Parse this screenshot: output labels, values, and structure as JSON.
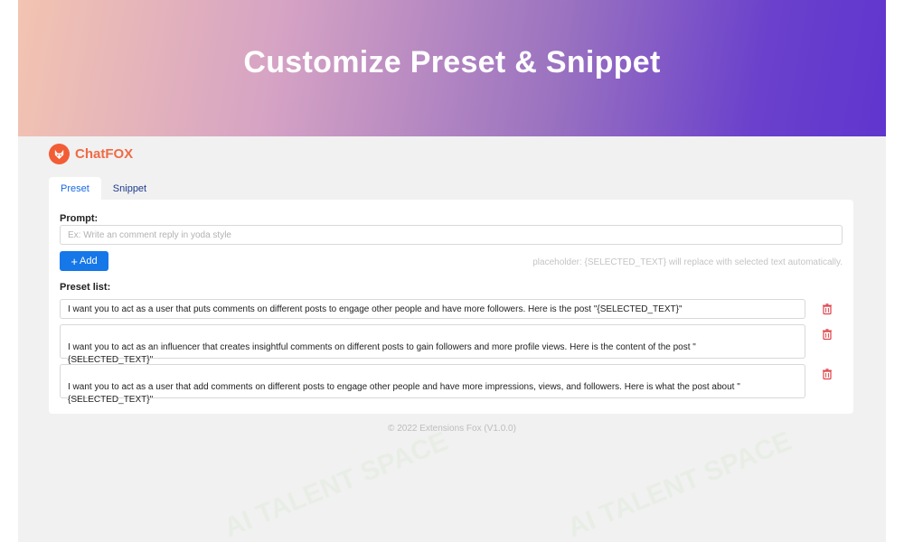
{
  "banner": {
    "title": "Customize Preset & Snippet"
  },
  "app": {
    "name": "ChatFOX"
  },
  "tabs": [
    {
      "label": "Preset",
      "active": true
    },
    {
      "label": "Snippet",
      "active": false
    }
  ],
  "prompt": {
    "label": "Prompt:",
    "value": "",
    "placeholder": "Ex: Write an comment reply in yoda style"
  },
  "add_button": {
    "label": "Add"
  },
  "hint": "placeholder: {SELECTED_TEXT} will replace with selected text automatically.",
  "preset_list": {
    "label": "Preset list:",
    "items": [
      "I want you to act as a user that puts comments on different posts to engage other people and have more followers. Here is the post \"{SELECTED_TEXT}\"",
      "I want you to act as an influencer that creates insightful comments on different posts to gain followers and more profile views. Here is the content of the post \"\n{SELECTED_TEXT}\"",
      "I want you to act as a user that add comments on different posts to engage other people and have more impressions, views, and followers. Here is what the post about \"\n{SELECTED_TEXT}\""
    ]
  },
  "footer": "© 2022 Extensions Fox (V1.0.0)",
  "watermark": "AI TALENT SPACE",
  "colors": {
    "accent": "#1677e8",
    "brand": "#f25d36",
    "delete": "#e0424a"
  }
}
